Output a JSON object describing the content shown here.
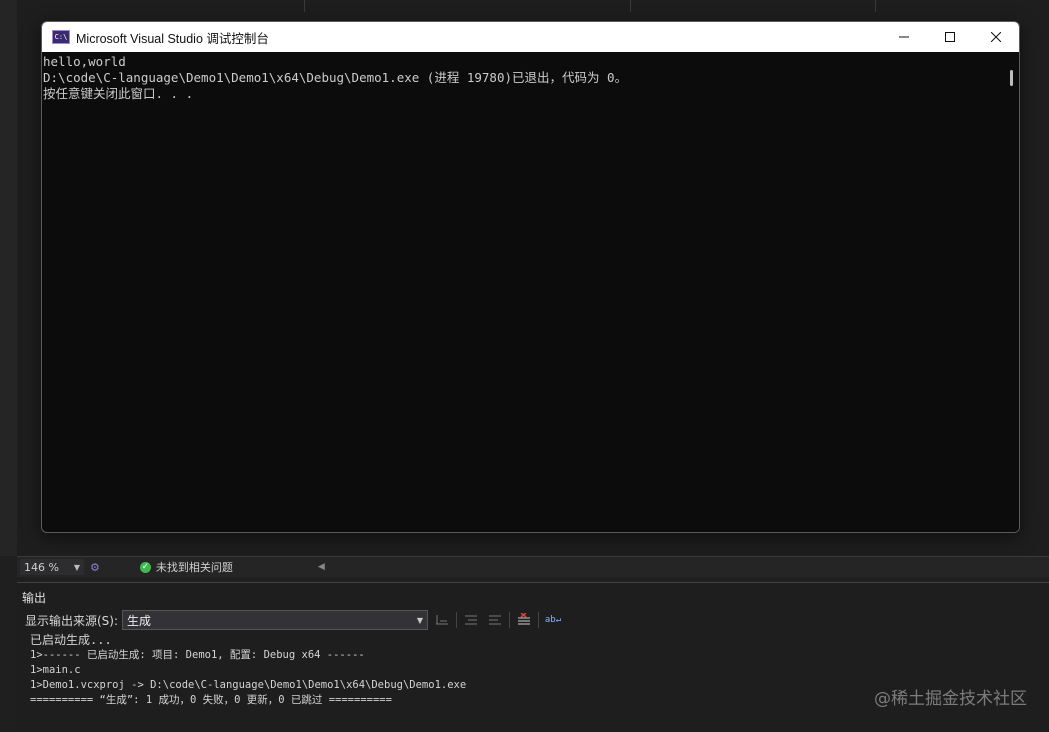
{
  "console": {
    "title": "Microsoft Visual Studio 调试控制台",
    "icon_text": "C:\\",
    "lines": [
      "hello,world",
      "D:\\code\\C-language\\Demo1\\Demo1\\x64\\Debug\\Demo1.exe (进程 19780)已退出，代码为 0。",
      "按任意键关闭此窗口. . ."
    ]
  },
  "status": {
    "zoom": "146 %",
    "problems": "未找到相关问题"
  },
  "output": {
    "title": "输出",
    "source_label": "显示输出来源(S):",
    "source_value": "生成",
    "lines": [
      "已启动生成...",
      "1>------ 已启动生成: 项目: Demo1, 配置: Debug x64 ------",
      "1>main.c",
      "1>Demo1.vcxproj -> D:\\code\\C-language\\Demo1\\Demo1\\x64\\Debug\\Demo1.exe",
      "========== “生成”: 1 成功，0 失败，0 更新，0 已跳过 =========="
    ]
  },
  "watermark": "@稀土掘金技术社区",
  "colors": {
    "console_bg": "#0c0c0c",
    "ide_bg": "#1e1e1e",
    "success": "#3fb950"
  },
  "icons": {
    "app": "console-app-icon",
    "minimize": "minimize-icon",
    "maximize": "maximize-icon",
    "close": "close-icon"
  }
}
